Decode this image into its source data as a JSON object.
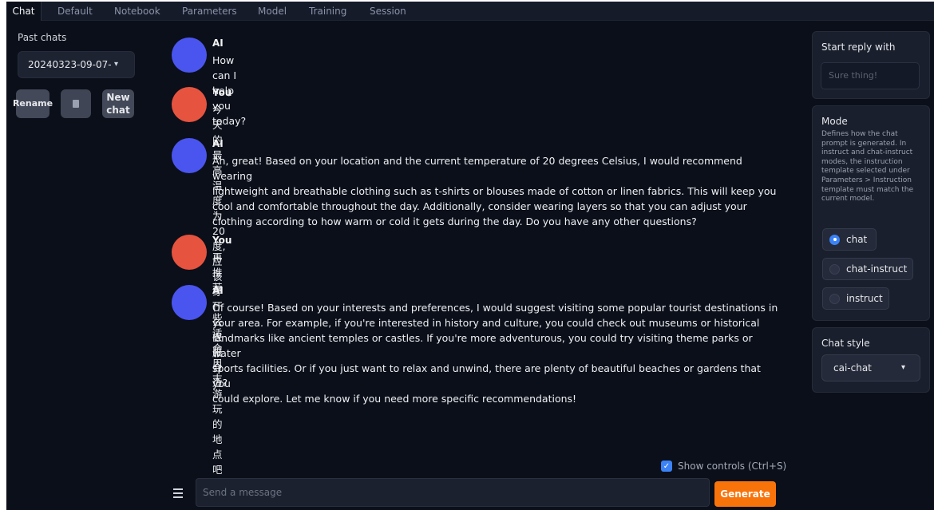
{
  "tabs": [
    "Chat",
    "Default",
    "Notebook",
    "Parameters",
    "Model",
    "Training",
    "Session"
  ],
  "sidebar": {
    "past_chats_label": "Past chats",
    "selected_chat": "20240323-09-07-",
    "selected_chat_chevron": "▾",
    "rename_label": "Rename",
    "new_chat_label": "New chat"
  },
  "messages": [
    {
      "author": "AI",
      "role": "ai",
      "text": "How can I help you today?"
    },
    {
      "author": "You",
      "role": "you",
      "text": "今天的最高温度为20度, 应该穿什么衣服合适?"
    },
    {
      "author": "AI",
      "role": "ai",
      "lines": [
        "Ah, great! Based on your location and the current temperature of 20 degrees Celsius, I would recommend wearing",
        "lightweight and breathable clothing such as t-shirts or blouses made of cotton or linen fabrics. This will keep you",
        "cool and comfortable throughout the day. Additionally, consider wearing layers so that you can adjust your",
        "clothing according to how warm or cold it gets during the day. Do you have any other questions?"
      ]
    },
    {
      "author": "You",
      "role": "you",
      "text": "再推荐一些适合周末游玩的地点吧"
    },
    {
      "author": "AI",
      "role": "ai",
      "lines": [
        "Of course! Based on your interests and preferences, I would suggest visiting some popular tourist destinations in",
        "your area. For example, if you're interested in history and culture, you could check out museums or historical",
        "landmarks like ancient temples or castles. If you're more adventurous, you could try visiting theme parks or water",
        "sports facilities. Or if you just want to relax and unwind, there are plenty of beautiful beaches or gardens that you",
        "could explore. Let me know if you need more specific recommendations!"
      ]
    }
  ],
  "input": {
    "show_controls_label": "Show controls (Ctrl+S)",
    "message_placeholder": "Send a message",
    "generate_label": "Generate"
  },
  "right": {
    "start_reply_label": "Start reply with",
    "start_reply_placeholder": "Sure thing!",
    "mode_label": "Mode",
    "mode_desc_lines": [
      "Defines how the chat",
      "prompt is generated. In",
      "instruct and chat-instruct",
      "modes, the instruction",
      "template selected under",
      "Parameters > Instruction",
      "template must match the",
      "current model."
    ],
    "mode_options": [
      "chat",
      "chat-instruct",
      "instruct"
    ],
    "mode_selected": "chat",
    "chat_style_label": "Chat style",
    "chat_style_value": "cai-chat",
    "chevron": "▾"
  },
  "colors": {
    "ai_avatar": "#4a55f0",
    "you_avatar": "#e6533f",
    "generate_button": "#f9730b",
    "background": "#0b0f19"
  }
}
